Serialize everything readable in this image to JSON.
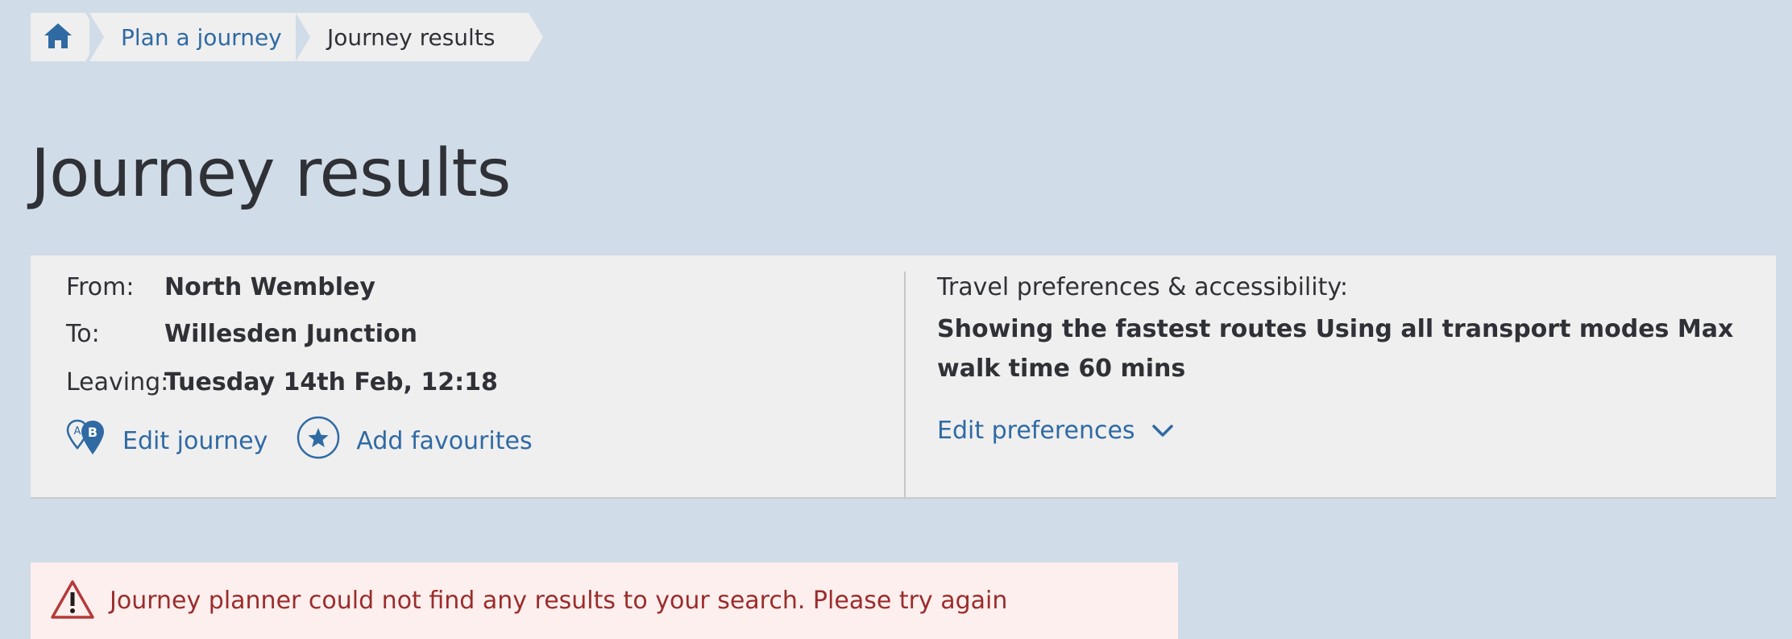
{
  "breadcrumb": {
    "home_icon": "home-icon",
    "items": [
      "Plan a journey",
      "Journey results"
    ]
  },
  "page": {
    "title": "Journey results"
  },
  "journey": {
    "from_label": "From:",
    "from_value": "North Wembley",
    "to_label": "To:",
    "to_value": "Willesden Junction",
    "leaving_label": "Leaving:",
    "leaving_value": "Tuesday 14th Feb, 12:18",
    "edit_journey": "Edit journey",
    "add_favourites": "Add favourites"
  },
  "preferences": {
    "title": "Travel preferences & accessibility:",
    "summary": "Showing the fastest routes Using all transport modes Max walk time 60 mins",
    "edit_label": "Edit preferences"
  },
  "error": {
    "message": "Journey planner could not find any results to your search. Please try again"
  },
  "colors": {
    "background": "#d0dce7",
    "link": "#2f6aa3",
    "error_text": "#9b2c2c",
    "error_bg": "#fdefed"
  }
}
